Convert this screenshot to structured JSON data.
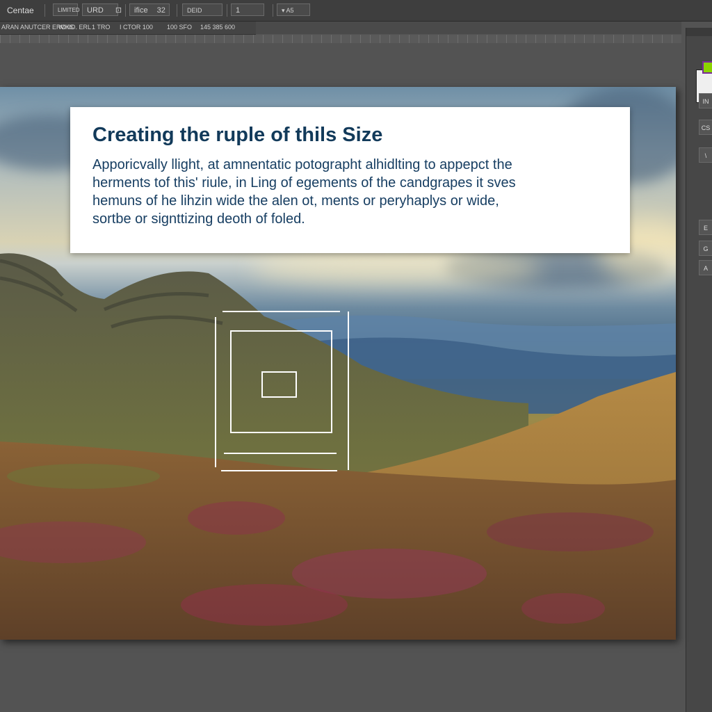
{
  "toolbar": {
    "app_title": "Centae",
    "box1": "LIMITED",
    "box2": "URD",
    "box2_suffix": "⊡",
    "box3": "ifice",
    "box3_value": "32",
    "box4": "DEID",
    "box5": "1",
    "box6": "▾ A5"
  },
  "options_bar": {
    "seg1": "ARAN ANUTCER ERCKS",
    "seg2": "WHIO. ERL",
    "seg3": "1 TRO",
    "seg4": "I CTOR 100",
    "seg5": "100 SFO",
    "seg6": "145 385 600"
  },
  "right_panel": {
    "btn1": "IN",
    "btn2": "CS",
    "btn3": "\\",
    "btn4": "E",
    "btn5": "G",
    "btn6": "A"
  },
  "card": {
    "title": "Creating the ruple of thils Size",
    "lines": [
      "Apporicvally llight, at amnentatic potographt alhidlting to appepct the",
      "herments tof this' riule, in Ling of egements of the candgrapes it sves",
      "hemuns of he lihzin wide the alen ot, ments or peryhaplys or wide,",
      "sortbe or signttizing deoth of foled."
    ]
  },
  "colors": {
    "title": "#123a5a",
    "body": "#173e62",
    "app_bg": "#535353",
    "accent_green": "#8bd300",
    "accent_purple": "#7a2a9a"
  },
  "icons": {
    "crop_frame": "crop-frame-icon",
    "transform_box": "transform-box-icon"
  }
}
